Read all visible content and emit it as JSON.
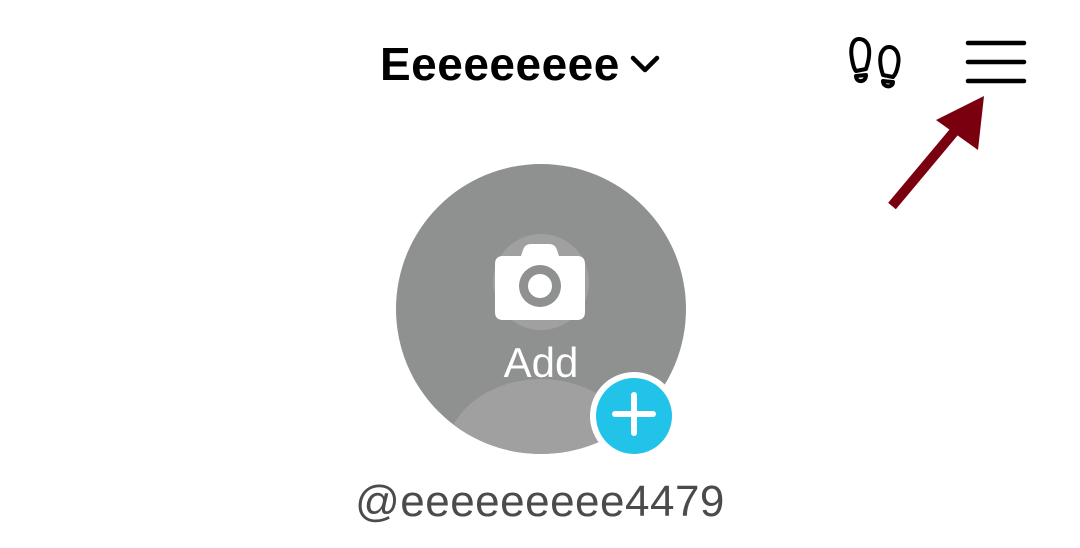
{
  "header": {
    "account_name": "Eeeeeeeee",
    "icons": {
      "switcher": "chevron-down-icon",
      "profile_views": "footprints-icon",
      "menu": "hamburger-menu-icon"
    }
  },
  "avatar": {
    "label": "Add",
    "camera_icon": "camera-icon",
    "badge_icon": "plus-icon"
  },
  "profile": {
    "username": "@eeeeeeeee4479"
  },
  "colors": {
    "avatar_bg": "#8f9090",
    "badge": "#21c4e8",
    "arrow": "#7a0010",
    "text_primary": "#000000",
    "text_secondary": "#4b4b4b"
  }
}
